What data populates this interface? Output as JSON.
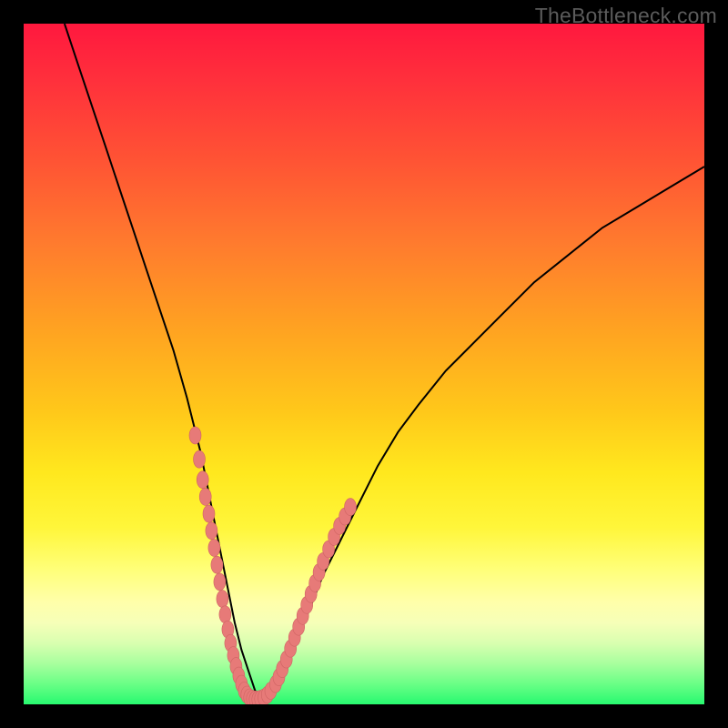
{
  "watermark": "TheBottleneck.com",
  "colors": {
    "curve_stroke": "#000000",
    "marker_fill": "#e77a78",
    "marker_stroke": "#cf6463"
  },
  "chart_data": {
    "type": "line",
    "title": "",
    "xlabel": "",
    "ylabel": "",
    "xlim": [
      0,
      100
    ],
    "ylim": [
      0,
      100
    ],
    "curve": {
      "x": [
        6,
        8,
        10,
        12,
        14,
        16,
        18,
        20,
        22,
        24,
        25,
        26,
        27,
        28,
        29,
        30,
        31,
        32,
        33,
        34,
        35,
        36,
        37,
        38,
        40,
        42,
        44,
        46,
        48,
        50,
        52,
        55,
        58,
        62,
        66,
        70,
        75,
        80,
        85,
        90,
        95,
        100
      ],
      "y": [
        100,
        94,
        88,
        82,
        76,
        70,
        64,
        58,
        52,
        45,
        41,
        37,
        32,
        27,
        22,
        17,
        12,
        8,
        5,
        2,
        1,
        1,
        2,
        4,
        9,
        14,
        19,
        23,
        27,
        31,
        35,
        40,
        44,
        49,
        53,
        57,
        62,
        66,
        70,
        73,
        76,
        79
      ]
    },
    "markers_left": {
      "x": [
        25.2,
        25.8,
        26.3,
        26.7,
        27.2,
        27.6,
        28.0,
        28.4,
        28.8,
        29.2,
        29.6,
        30.0,
        30.4,
        30.8,
        31.2,
        31.6,
        32.0,
        32.4,
        32.8,
        33.2,
        33.6,
        34.0,
        34.4,
        34.8,
        35.3,
        35.8,
        36.3
      ],
      "y": [
        39.5,
        36.0,
        33.0,
        30.5,
        28.0,
        25.5,
        23.0,
        20.5,
        18.0,
        15.5,
        13.2,
        11.0,
        9.0,
        7.2,
        5.6,
        4.2,
        3.0,
        2.0,
        1.4,
        1.0,
        0.8,
        0.7,
        0.7,
        0.8,
        1.0,
        1.4,
        2.0
      ]
    },
    "markers_right": {
      "x": [
        37.0,
        37.5,
        38.0,
        38.6,
        39.2,
        39.8,
        40.4,
        41.0,
        41.6,
        42.2,
        42.8,
        43.4,
        44.0,
        44.8,
        45.6,
        46.4,
        47.2,
        48.0
      ],
      "y": [
        3.0,
        4.0,
        5.2,
        6.6,
        8.2,
        9.8,
        11.4,
        13.0,
        14.6,
        16.2,
        17.8,
        19.4,
        21.0,
        22.8,
        24.6,
        26.2,
        27.6,
        29.0
      ]
    }
  }
}
